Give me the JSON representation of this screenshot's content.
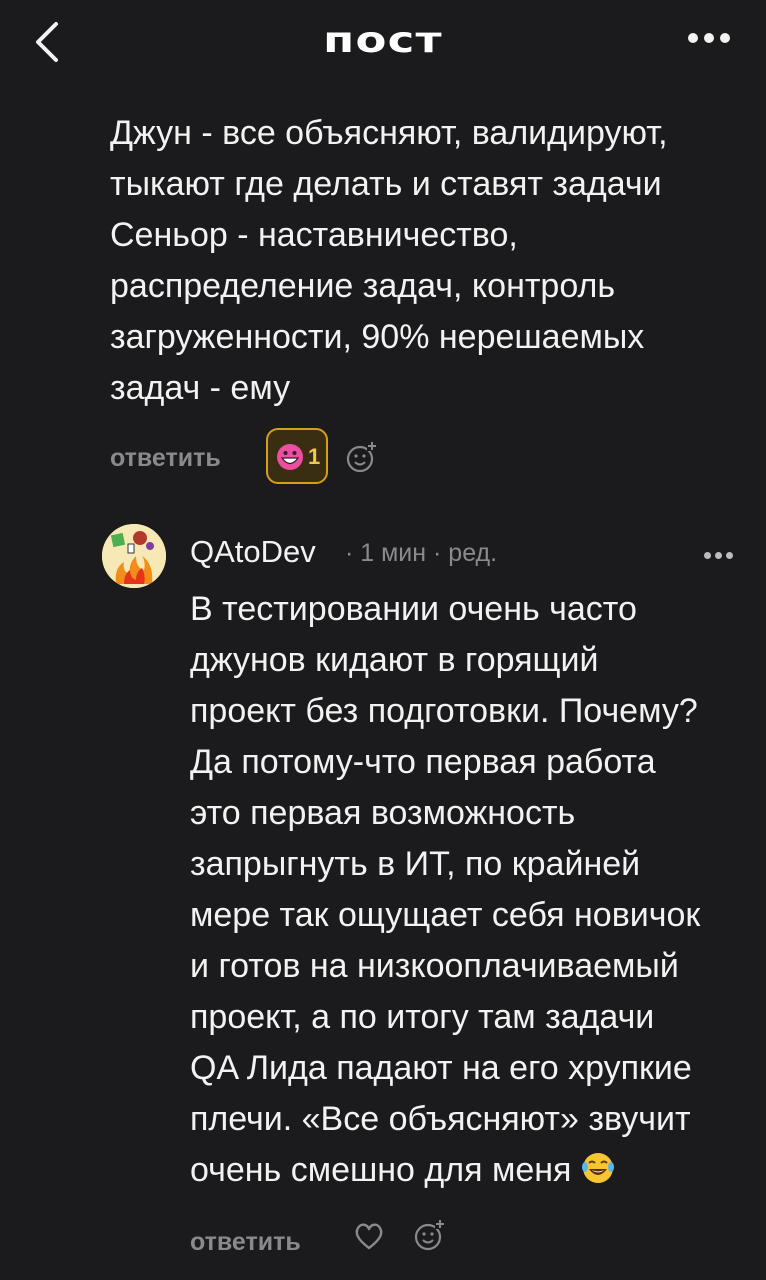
{
  "header": {
    "title": "пост",
    "back_icon": "chevron-left-icon",
    "more_icon": "more-horizontal-icon"
  },
  "previous_comment": {
    "text": "Джун - все объясняют, валидируют,\nтыкают где делать и ставят задачи\nСеньор - наставничество,\nраспределение задач, контроль\nзагруженности, 90% нерешаемых\nзадач - ему",
    "reply_label": "ответить",
    "reaction": {
      "emoji": "grinning-face-emoji",
      "count": "1"
    },
    "add_reaction_icon": "add-reaction-icon"
  },
  "comment": {
    "author": "QAtoDev",
    "meta": "· 1 мин · ред.",
    "text": "В тестировании очень часто\nджунов кидают в горящий\nпроект без подготовки. Почему?\nДа потому-что первая работа\nэто первая возможность\nзапрыгнуть в ИТ, по крайней\nмере так ощущает себя новичок\nи готов на низкооплачиваемый\nпроект, а по итогу там задачи\nQA Лида падают на его хрупкие\nплечи. «Все объясняют» звучит\nочень смешно для меня ",
    "trailing_emoji": "face-with-tears-of-joy-emoji",
    "reply_label": "ответить",
    "like_icon": "heart-icon",
    "add_reaction_icon": "add-reaction-icon"
  },
  "colors": {
    "background": "#1b1a1c",
    "text": "#f2f2f2",
    "muted": "#8a8a8e",
    "reaction_border": "#d4a017"
  }
}
